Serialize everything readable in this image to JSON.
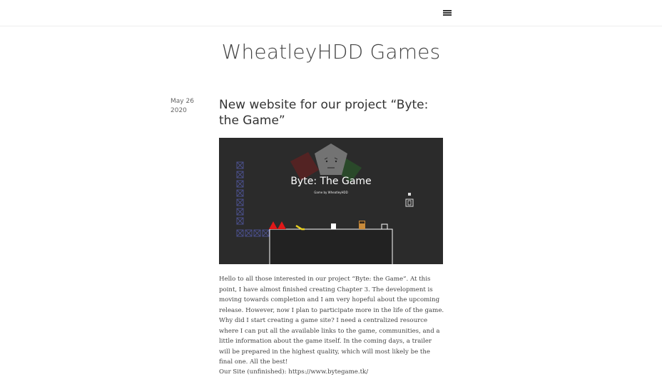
{
  "header": {
    "menu_icon": "hamburger-menu-icon"
  },
  "site": {
    "title": "WheatleyHDD Games"
  },
  "post": {
    "date_month_day": "May 26",
    "date_year": "2020",
    "title": "New website for our project “Byte: the Game”",
    "image": {
      "game_title": "Byte: The Game",
      "game_subtitle": "Game by WheatleyHDD"
    },
    "body": "Hello to all those interested in our project “Byte: the Game”. At this point, I have almost finished creating Chapter 3. The development is moving towards completion and I am very hopeful about the upcoming release. However, now I plan to participate more in the life of the game. Why did I start creating a game site? I need a centralized resource where I can put all the available links to the game, communities, and a little information about the game itself. In the coming days, a trailer will be prepared in the highest quality, which will most likely be the final one. All the best!",
    "site_label": "Our Site (unfinished): ",
    "site_url": "https://www.bytegame.tk/"
  },
  "colors": {
    "page_bg": "#ffffff",
    "image_bg": "#2b2b2b",
    "text": "#444444"
  }
}
